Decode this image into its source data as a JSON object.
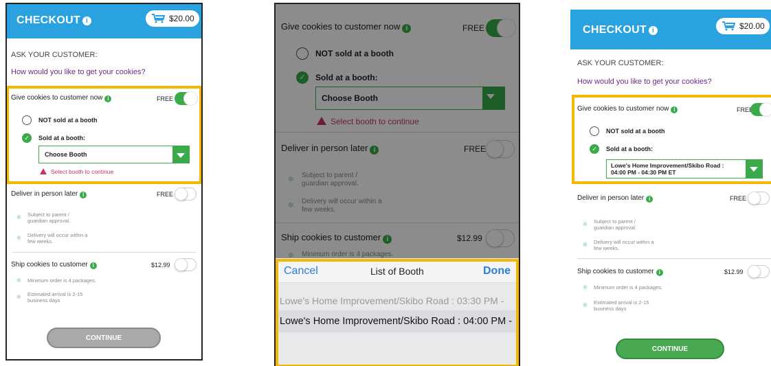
{
  "screens": [
    {
      "header": {
        "title": "CHECKOUT",
        "cart_total": "$20.00"
      },
      "ask_label": "ASK YOUR CUSTOMER:",
      "question": "How would you like to get your cookies?",
      "give_now": {
        "title": "Give cookies to customer now",
        "price": "FREE",
        "enabled": true,
        "options": [
          {
            "label": "NOT sold at a booth",
            "selected": false
          },
          {
            "label": "Sold at a booth:",
            "selected": true
          }
        ],
        "booth_select": "Choose Booth",
        "warning": "Select booth to continue"
      },
      "deliver_later": {
        "title": "Deliver in person later",
        "price": "FREE",
        "enabled": false,
        "bullets": [
          "Subject to parent /\nguardian approval.",
          "Delivery will occur within a\nfew weeks."
        ]
      },
      "ship": {
        "title": "Ship cookies to customer",
        "price": "$12.99",
        "enabled": false,
        "bullets": [
          "Minimum order is 4 packages.",
          "Estimated arrival is 2-15\nbusiness days"
        ]
      },
      "continue_label": "CONTINUE",
      "continue_enabled": false
    },
    {
      "give_now": {
        "title": "Give cookies to customer now",
        "price": "FREE",
        "options": [
          {
            "label": "NOT sold at a booth"
          },
          {
            "label": "Sold at a booth:"
          }
        ],
        "booth_select": "Choose Booth",
        "warning": "Select booth to continue"
      },
      "deliver_later": {
        "title": "Deliver in person later",
        "price": "FREE",
        "bullets": [
          "Subject to parent /\nguardian approval.",
          "Delivery will occur within a\nfew weeks."
        ]
      },
      "ship": {
        "title": "Ship cookies to customer",
        "price": "$12.99",
        "bullets": [
          "Minimum order is 4 packages."
        ]
      },
      "picker": {
        "cancel": "Cancel",
        "title": "List of Booth",
        "done": "Done",
        "rows": [
          "Lowe's Home Improvement/Skibo Road : 03:30 PM -",
          "Lowe's Home Improvement/Skibo Road : 04:00 PM -"
        ]
      }
    },
    {
      "header": {
        "title": "CHECKOUT",
        "cart_total": "$20.00"
      },
      "ask_label": "ASK YOUR CUSTOMER:",
      "question": "How would you like to get your cookies?",
      "give_now": {
        "title": "Give cookies to customer now",
        "price": "FREE",
        "options": [
          {
            "label": "NOT sold at a booth"
          },
          {
            "label": "Sold at a booth:"
          }
        ],
        "booth_select_line1": "Lowe's Home Improvement/Skibo Road :",
        "booth_select_line2": "04:00 PM - 04:30 PM ET"
      },
      "deliver_later": {
        "title": "Deliver in person later",
        "price": "FREE",
        "bullets": [
          "Subject to parent /\nguardian approval.",
          "Delivery will occur within a\nfew weeks."
        ]
      },
      "ship": {
        "title": "Ship cookies to customer",
        "price": "$12.99",
        "bullets": [
          "Minimum order is 4 packages.",
          "Estimated arrival is 2-15\nbusiness days"
        ]
      },
      "continue_label": "CONTINUE",
      "continue_enabled": true
    }
  ],
  "colors": {
    "header": "#2aa2e0",
    "accent_green": "#3aaa4a",
    "highlight": "#f5b800",
    "question": "#6b2a86",
    "warning": "#c8326e",
    "picker_link": "#2a7ed8"
  },
  "icons": [
    "info-icon",
    "cart-icon",
    "check-icon",
    "warning-icon",
    "chevron-down-icon",
    "bullet-star-icon"
  ]
}
